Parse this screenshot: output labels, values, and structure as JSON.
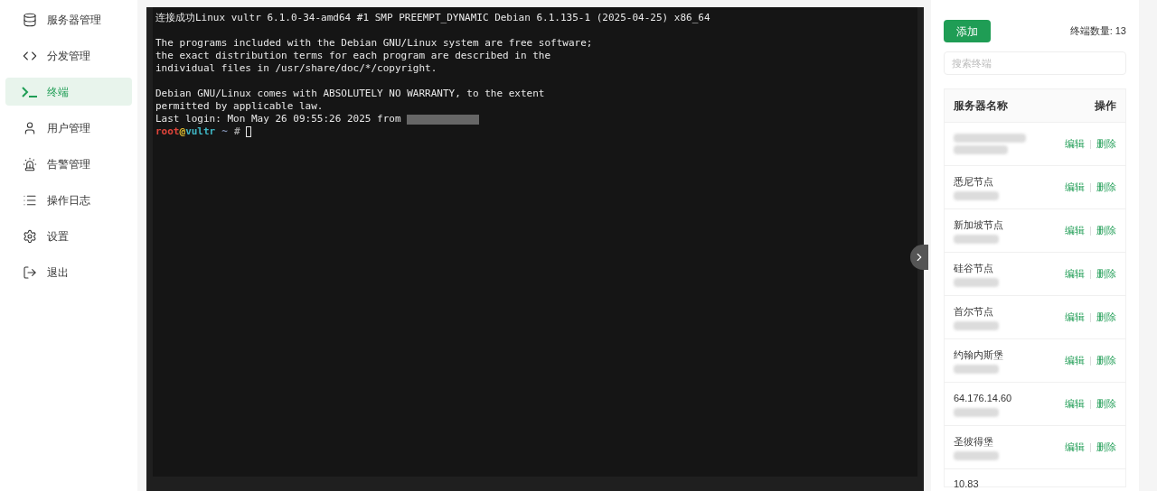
{
  "sidebar": {
    "items": [
      {
        "label": "服务器管理",
        "selected": false
      },
      {
        "label": "分发管理",
        "selected": false
      },
      {
        "label": "终端",
        "selected": true
      },
      {
        "label": "用户管理",
        "selected": false
      },
      {
        "label": "告警管理",
        "selected": false
      },
      {
        "label": "操作日志",
        "selected": false
      },
      {
        "label": "设置",
        "selected": false
      },
      {
        "label": "退出",
        "selected": false
      }
    ]
  },
  "terminal": {
    "lines": [
      {
        "text": "连接成功Linux vultr 6.1.0-34-amd64 #1 SMP PREEMPT_DYNAMIC Debian 6.1.135-1 (2025-04-25) x86_64"
      },
      {
        "kind": "blank"
      },
      {
        "text": "The programs included with the Debian GNU/Linux system are free software;"
      },
      {
        "text": "the exact distribution terms for each program are described in the"
      },
      {
        "text": "individual files in /usr/share/doc/*/copyright."
      },
      {
        "kind": "blank"
      },
      {
        "text": "Debian GNU/Linux comes with ABSOLUTELY NO WARRANTY, to the extent"
      },
      {
        "text": "permitted by applicable law."
      },
      {
        "text": "Last login: Mon May 26 09:55:26 2025 from",
        "redacted": true
      }
    ],
    "prompt": [
      {
        "text": "root",
        "color": "#e0443a"
      },
      {
        "text": "@",
        "color": "#e5c230"
      },
      {
        "text": "vultr",
        "color": "#3fb6c4"
      },
      {
        "text": "~",
        "color": "#7f8fb0"
      },
      {
        "text": "#",
        "color": "#9a9a9a"
      }
    ]
  },
  "panel": {
    "add_button": "添加",
    "count_label": "终端数量:",
    "count": "13",
    "search": {
      "placeholder": "搜索终端"
    },
    "columns": [
      "服务器名称",
      "操作"
    ],
    "rows": [
      {
        "edit": "编辑",
        "delete": "删除"
      },
      {
        "name": "悉尼节点",
        "edit": "编辑",
        "delete": "删除"
      },
      {
        "name": "新加坡节点",
        "edit": "编辑",
        "delete": "删除"
      },
      {
        "name": "硅谷节点",
        "edit": "编辑",
        "delete": "删除"
      },
      {
        "name": "首尔节点",
        "edit": "编辑",
        "delete": "删除"
      },
      {
        "name": "约翰内斯堡",
        "edit": "编辑",
        "delete": "删除"
      },
      {
        "name": "64.176.14.60",
        "edit": "编辑",
        "delete": "删除"
      },
      {
        "name": "圣彼得堡",
        "edit": "编辑",
        "delete": "删除"
      }
    ],
    "cut_row": "10.83"
  }
}
